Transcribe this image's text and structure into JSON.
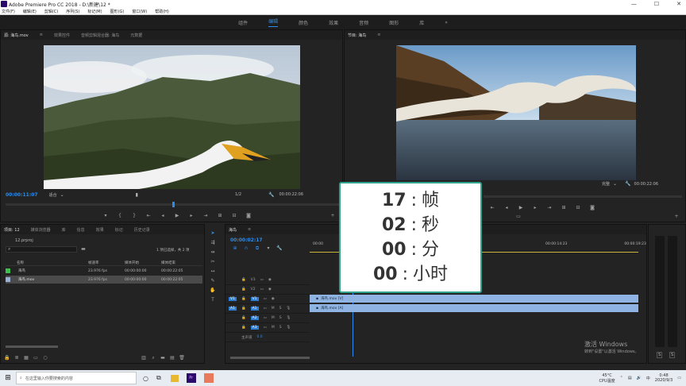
{
  "window": {
    "title": "Adobe Premiere Pro CC 2018 - D:\\新建\\12 *",
    "controls": [
      "—",
      "☐",
      "✕"
    ]
  },
  "menu": [
    "文件(F)",
    "编辑(E)",
    "剪辑(C)",
    "序列(S)",
    "标记(M)",
    "图形(G)",
    "窗口(W)",
    "帮助(H)"
  ],
  "workspaces": {
    "items": [
      "组件",
      "编辑",
      "颜色",
      "效果",
      "音频",
      "图形",
      "库",
      "»"
    ],
    "active_index": 1
  },
  "source_panel": {
    "tabs": [
      "源: 海鸟.mov",
      "效果控件",
      "音频剪辑混合器: 海鸟",
      "元数据"
    ],
    "menu_icon": "≡",
    "timecode": "00:00:11:07",
    "fit": "适合",
    "scale": "1/2",
    "duration": "00:00:22:06"
  },
  "program_panel": {
    "title": "节目: 海鸟",
    "menu_icon": "≡",
    "fit": "完整",
    "duration": "00:00:22:06"
  },
  "project_panel": {
    "tabs": [
      "项目: 12",
      "媒体浏览器",
      "库",
      "信息",
      "效果",
      "标记",
      "历史记录"
    ],
    "file": "12.prproj",
    "selection": "1 项已选择，共 2 项",
    "columns": [
      "名称",
      "帧速率",
      "媒体开始",
      "媒体结束"
    ],
    "rows": [
      {
        "name": "海鸟",
        "fps": "23.976 fps",
        "start": "00:00:00:00",
        "end": "00:00:22:05"
      },
      {
        "name": "海鸟.mov",
        "fps": "23.976 fps",
        "start": "00:00:00:00",
        "end": "00:00:22:05"
      }
    ]
  },
  "timeline": {
    "tab": "海鸟",
    "menu_icon": "≡",
    "timecode": "00:00:02:17",
    "ruler": [
      "00:00",
      "00:00:14:23",
      "00:00:19:23"
    ],
    "tracks_video": [
      "V3",
      "V2",
      "V1"
    ],
    "tracks_audio": [
      "A1",
      "A2",
      "A3"
    ],
    "master": "主声道",
    "master_value": "0.0",
    "clip_video": "海鸟.mov [V]",
    "clip_audio": "海鸟.mov [A]",
    "track_buttons": {
      "mute": "M",
      "solo": "S"
    }
  },
  "overlay": {
    "lines": [
      {
        "num": "17",
        "sep": ":",
        "unit": "帧"
      },
      {
        "num": "02",
        "sep": ":",
        "unit": "秒"
      },
      {
        "num": "00",
        "sep": ":",
        "unit": "分"
      },
      {
        "num": "00",
        "sep": ":",
        "unit": "小时"
      }
    ]
  },
  "watermark": {
    "line1": "激活 Windows",
    "line2": "转到\"设置\"以激活 Windows。"
  },
  "taskbar": {
    "search_placeholder": "在这里输入你要搜索的内容",
    "temp": "45°C",
    "cpu": "CPU温度",
    "ime": "中",
    "time": "0:48",
    "date": "2020/9/3"
  },
  "meter": {
    "labels": [
      "S",
      "S"
    ]
  },
  "colors": {
    "accent": "#2d8ceb",
    "overlay_border": "#2fa38c",
    "clip": "#8fb4e3"
  }
}
